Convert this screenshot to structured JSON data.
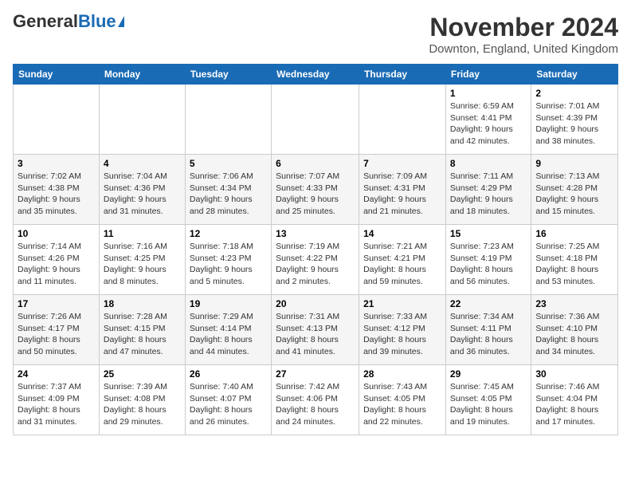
{
  "header": {
    "logo_general": "General",
    "logo_blue": "Blue",
    "month_title": "November 2024",
    "location": "Downton, England, United Kingdom"
  },
  "calendar": {
    "days_of_week": [
      "Sunday",
      "Monday",
      "Tuesday",
      "Wednesday",
      "Thursday",
      "Friday",
      "Saturday"
    ],
    "weeks": [
      [
        {
          "day": "",
          "info": ""
        },
        {
          "day": "",
          "info": ""
        },
        {
          "day": "",
          "info": ""
        },
        {
          "day": "",
          "info": ""
        },
        {
          "day": "",
          "info": ""
        },
        {
          "day": "1",
          "info": "Sunrise: 6:59 AM\nSunset: 4:41 PM\nDaylight: 9 hours\nand 42 minutes."
        },
        {
          "day": "2",
          "info": "Sunrise: 7:01 AM\nSunset: 4:39 PM\nDaylight: 9 hours\nand 38 minutes."
        }
      ],
      [
        {
          "day": "3",
          "info": "Sunrise: 7:02 AM\nSunset: 4:38 PM\nDaylight: 9 hours\nand 35 minutes."
        },
        {
          "day": "4",
          "info": "Sunrise: 7:04 AM\nSunset: 4:36 PM\nDaylight: 9 hours\nand 31 minutes."
        },
        {
          "day": "5",
          "info": "Sunrise: 7:06 AM\nSunset: 4:34 PM\nDaylight: 9 hours\nand 28 minutes."
        },
        {
          "day": "6",
          "info": "Sunrise: 7:07 AM\nSunset: 4:33 PM\nDaylight: 9 hours\nand 25 minutes."
        },
        {
          "day": "7",
          "info": "Sunrise: 7:09 AM\nSunset: 4:31 PM\nDaylight: 9 hours\nand 21 minutes."
        },
        {
          "day": "8",
          "info": "Sunrise: 7:11 AM\nSunset: 4:29 PM\nDaylight: 9 hours\nand 18 minutes."
        },
        {
          "day": "9",
          "info": "Sunrise: 7:13 AM\nSunset: 4:28 PM\nDaylight: 9 hours\nand 15 minutes."
        }
      ],
      [
        {
          "day": "10",
          "info": "Sunrise: 7:14 AM\nSunset: 4:26 PM\nDaylight: 9 hours\nand 11 minutes."
        },
        {
          "day": "11",
          "info": "Sunrise: 7:16 AM\nSunset: 4:25 PM\nDaylight: 9 hours\nand 8 minutes."
        },
        {
          "day": "12",
          "info": "Sunrise: 7:18 AM\nSunset: 4:23 PM\nDaylight: 9 hours\nand 5 minutes."
        },
        {
          "day": "13",
          "info": "Sunrise: 7:19 AM\nSunset: 4:22 PM\nDaylight: 9 hours\nand 2 minutes."
        },
        {
          "day": "14",
          "info": "Sunrise: 7:21 AM\nSunset: 4:21 PM\nDaylight: 8 hours\nand 59 minutes."
        },
        {
          "day": "15",
          "info": "Sunrise: 7:23 AM\nSunset: 4:19 PM\nDaylight: 8 hours\nand 56 minutes."
        },
        {
          "day": "16",
          "info": "Sunrise: 7:25 AM\nSunset: 4:18 PM\nDaylight: 8 hours\nand 53 minutes."
        }
      ],
      [
        {
          "day": "17",
          "info": "Sunrise: 7:26 AM\nSunset: 4:17 PM\nDaylight: 8 hours\nand 50 minutes."
        },
        {
          "day": "18",
          "info": "Sunrise: 7:28 AM\nSunset: 4:15 PM\nDaylight: 8 hours\nand 47 minutes."
        },
        {
          "day": "19",
          "info": "Sunrise: 7:29 AM\nSunset: 4:14 PM\nDaylight: 8 hours\nand 44 minutes."
        },
        {
          "day": "20",
          "info": "Sunrise: 7:31 AM\nSunset: 4:13 PM\nDaylight: 8 hours\nand 41 minutes."
        },
        {
          "day": "21",
          "info": "Sunrise: 7:33 AM\nSunset: 4:12 PM\nDaylight: 8 hours\nand 39 minutes."
        },
        {
          "day": "22",
          "info": "Sunrise: 7:34 AM\nSunset: 4:11 PM\nDaylight: 8 hours\nand 36 minutes."
        },
        {
          "day": "23",
          "info": "Sunrise: 7:36 AM\nSunset: 4:10 PM\nDaylight: 8 hours\nand 34 minutes."
        }
      ],
      [
        {
          "day": "24",
          "info": "Sunrise: 7:37 AM\nSunset: 4:09 PM\nDaylight: 8 hours\nand 31 minutes."
        },
        {
          "day": "25",
          "info": "Sunrise: 7:39 AM\nSunset: 4:08 PM\nDaylight: 8 hours\nand 29 minutes."
        },
        {
          "day": "26",
          "info": "Sunrise: 7:40 AM\nSunset: 4:07 PM\nDaylight: 8 hours\nand 26 minutes."
        },
        {
          "day": "27",
          "info": "Sunrise: 7:42 AM\nSunset: 4:06 PM\nDaylight: 8 hours\nand 24 minutes."
        },
        {
          "day": "28",
          "info": "Sunrise: 7:43 AM\nSunset: 4:05 PM\nDaylight: 8 hours\nand 22 minutes."
        },
        {
          "day": "29",
          "info": "Sunrise: 7:45 AM\nSunset: 4:05 PM\nDaylight: 8 hours\nand 19 minutes."
        },
        {
          "day": "30",
          "info": "Sunrise: 7:46 AM\nSunset: 4:04 PM\nDaylight: 8 hours\nand 17 minutes."
        }
      ]
    ]
  }
}
